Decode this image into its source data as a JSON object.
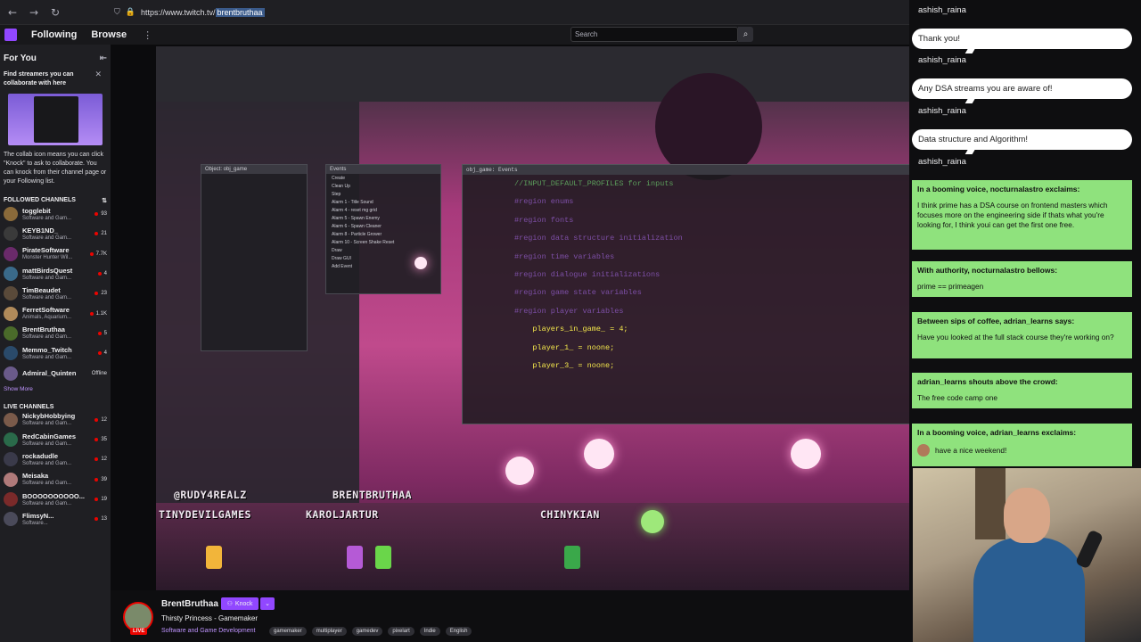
{
  "browser": {
    "url_prefix": "https://www.twitch.tv/",
    "url_highlight": "brentbruthaa"
  },
  "topnav": {
    "following": "Following",
    "browse": "Browse",
    "more": "⋮",
    "search_placeholder": "Search"
  },
  "sidebar": {
    "for_you": "For You",
    "promo_title": "Find streamers you can collaborate with here",
    "promo_text": "The collab icon means you can click \"Knock\" to ask to collaborate. You can knock from their channel page or your Following list.",
    "followed_title": "FOLLOWED CHANNELS",
    "followed": [
      {
        "name": "togglebit",
        "cat": "Software and Gam...",
        "viewers": "93",
        "color": "#8a6a3a"
      },
      {
        "name": "KEYB1ND_",
        "cat": "Software and Gam...",
        "viewers": "21",
        "color": "#3a3a3a"
      },
      {
        "name": "PirateSoftware",
        "cat": "Monster Hunter Wil...",
        "viewers": "7.7K",
        "color": "#6a2a6a"
      },
      {
        "name": "mattBirdsQuest",
        "cat": "Software and Gam...",
        "viewers": "4",
        "color": "#3a6a8a"
      },
      {
        "name": "TimBeaudet",
        "cat": "Software and Gam...",
        "viewers": "23",
        "color": "#5a4a3a"
      },
      {
        "name": "FerretSoftware",
        "cat": "Animals, Aquarium...",
        "viewers": "1.1K",
        "color": "#b08a5a"
      },
      {
        "name": "BrentBruthaa",
        "cat": "Software and Gam...",
        "viewers": "5",
        "color": "#4a6a2a"
      },
      {
        "name": "Memmo_Twitch",
        "cat": "Software and Gam...",
        "viewers": "4",
        "color": "#2a4a6a"
      },
      {
        "name": "Admiral_Quinten",
        "cat": "",
        "viewers": "Offline",
        "color": "#6a5a8a"
      }
    ],
    "show_more": "Show More",
    "live_title": "LIVE CHANNELS",
    "live": [
      {
        "name": "NickybHobbying",
        "cat": "Software and Gam...",
        "viewers": "12",
        "color": "#7a5a4a"
      },
      {
        "name": "RedCabinGames",
        "cat": "Software and Gam...",
        "viewers": "35",
        "color": "#2a6a4a"
      },
      {
        "name": "rockadudle",
        "cat": "Software and Gam...",
        "viewers": "12",
        "color": "#3a3a4a"
      },
      {
        "name": "Meisaka",
        "cat": "Software and Gam...",
        "viewers": "39",
        "color": "#b07a7a"
      },
      {
        "name": "BOOOOOOOOOO...",
        "cat": "Software and Gam...",
        "viewers": "19",
        "color": "#7a2a2a"
      },
      {
        "name": "FlimsyN...",
        "cat": "Software...",
        "viewers": "13",
        "color": "#4a4a5a"
      }
    ]
  },
  "stream": {
    "channel": "BrentBruthaa",
    "live_label": "LIVE",
    "knock_label": "Knock",
    "title": "Thirsty Princess - Gamemaker",
    "category": "Software and Game Development",
    "tags": [
      "gamemaker",
      "multiplayer",
      "gamedev",
      "pixelart",
      "Indie",
      "English"
    ]
  },
  "video": {
    "nametags": [
      "@RUDY4REALZ",
      "BRENTBRUTHAA",
      "TINYDEVILGAMES",
      "KAROLJARTUR",
      "CHINYKIAN"
    ],
    "code_lines": [
      {
        "cls": "c-cmt",
        "text": "//INPUT_DEFAULT_PROFILES for inputs"
      },
      {
        "cls": "c-reg",
        "text": "#region enums"
      },
      {
        "cls": "c-reg",
        "text": "#region fonts"
      },
      {
        "cls": "c-reg",
        "text": "#region data structure initialization"
      },
      {
        "cls": "c-reg",
        "text": "#region time variables"
      },
      {
        "cls": "c-reg",
        "text": "#region dialogue initializations"
      },
      {
        "cls": "c-reg",
        "text": "#region game state variables"
      },
      {
        "cls": "c-ln",
        "text": ""
      },
      {
        "cls": "c-reg",
        "text": "#region player variables"
      },
      {
        "cls": "c-var",
        "text": "    players_in_game_ = 4;"
      },
      {
        "cls": "c-ln",
        "text": ""
      },
      {
        "cls": "c-var",
        "text": "    player_1_ = noone;"
      },
      {
        "cls": "c-var",
        "text": "    player_3_ = noone;"
      }
    ],
    "events": [
      "Create",
      "Clean Up",
      "Step",
      "Alarm 1 - Title Sound",
      "Alarm 4 - reset mg grid",
      "Alarm 5 - Spawn Enemy",
      "Alarm 6 - Spawn Cleaner",
      "Alarm 8 - Particle Grower",
      "Alarm 10 - Screen Shake Reset",
      "Draw",
      "Draw GUI",
      "Add Event"
    ],
    "object_panel_title": "Object: obj_game",
    "events_panel_title": "Events",
    "code_panel_title": "obj_game: Events"
  },
  "chat": {
    "bubbles": [
      {
        "user": "ashish_raina",
        "text": ""
      },
      {
        "user": "ashish_raina",
        "text": "Thank you!"
      },
      {
        "user": "ashish_raina",
        "text": "Any DSA streams you are aware of!"
      },
      {
        "user": "ashish_raina",
        "text": "Data structure and Algorithm!"
      }
    ],
    "green": [
      {
        "head": "In a booming voice, nocturnalastro exclaims:",
        "body": "I think prime has a DSA course on frontend masters which focuses more on the engineering side if thats what you're looking for, I think youi can get the first one free."
      },
      {
        "head": "With authority, nocturnalastro bellows:",
        "body": "prime == primeagen"
      },
      {
        "head": "Between sips of coffee, adrian_learns says:",
        "body": "Have you looked at the full stack course they're working on?"
      },
      {
        "head": "adrian_learns shouts above the crowd:",
        "body": "The free code camp one"
      },
      {
        "head": "In a booming voice, adrian_learns exclaims:",
        "body": "have a nice weekend!"
      }
    ]
  }
}
